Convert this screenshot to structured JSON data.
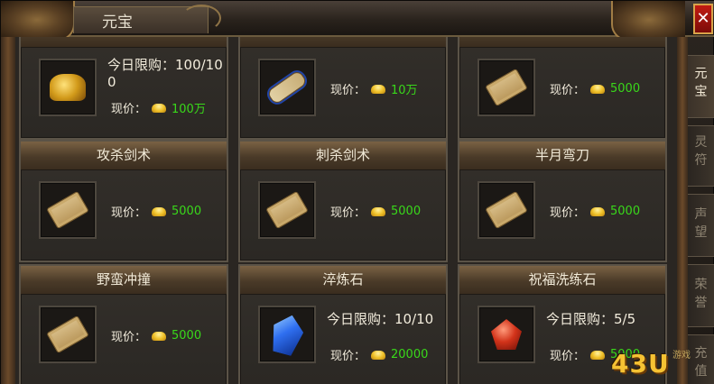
{
  "window": {
    "title": "元宝",
    "close_label": "✕"
  },
  "tabs": [
    {
      "label": "元\n宝",
      "active": true
    },
    {
      "label": "灵\n符",
      "active": false
    },
    {
      "label": "声\n望",
      "active": false
    },
    {
      "label": "荣\n誉",
      "active": false
    },
    {
      "label": "充\n值",
      "active": false
    }
  ],
  "price_label": "现价：",
  "items": [
    {
      "name": "",
      "limit": "今日限购：100/100",
      "price": "100万",
      "icon": "gold-pile-icon"
    },
    {
      "name": "",
      "limit": "",
      "price": "10万",
      "icon": "scroll-icon"
    },
    {
      "name": "",
      "limit": "",
      "price": "5000",
      "icon": "skill-book-icon"
    },
    {
      "name": "攻杀剑术",
      "limit": "",
      "price": "5000",
      "icon": "skill-book-icon"
    },
    {
      "name": "刺杀剑术",
      "limit": "",
      "price": "5000",
      "icon": "skill-book-icon"
    },
    {
      "name": "半月弯刀",
      "limit": "",
      "price": "5000",
      "icon": "skill-book-icon"
    },
    {
      "name": "野蛮冲撞",
      "limit": "",
      "price": "5000",
      "icon": "skill-book-icon"
    },
    {
      "name": "淬炼石",
      "limit": "今日限购：10/10",
      "price": "20000",
      "icon": "blue-crystal-icon"
    },
    {
      "name": "祝福洗练石",
      "limit": "今日限购：5/5",
      "price": "5000",
      "icon": "red-gem-icon"
    }
  ],
  "watermark": {
    "text": "43U",
    "sub": "游戏"
  },
  "colors": {
    "price_green": "#39d81a",
    "header_brown": "#4a3a28",
    "close_red": "#c21b12"
  }
}
